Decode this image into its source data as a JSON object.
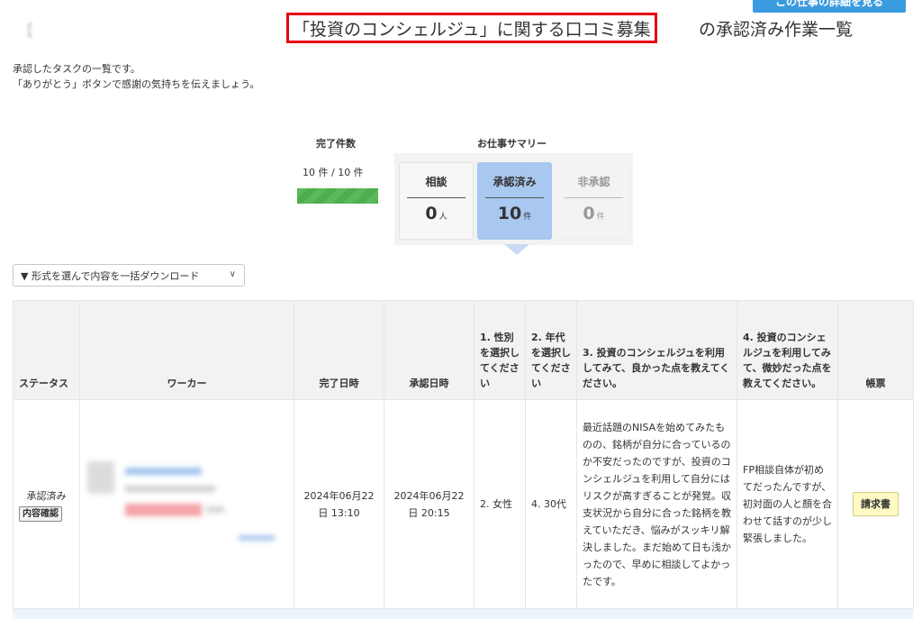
{
  "header": {
    "title_prefix": "【",
    "highlighted_title": "「投資のコンシェルジュ」に関する口コミ募集",
    "title_suffix": "の承認済み作業一覧",
    "detail_button": "この仕事の詳細を見る"
  },
  "description": {
    "line1": "承認したタスクの一覧です。",
    "line2": "「ありがとう」ボタンで感謝の気持ちを伝えましょう。"
  },
  "summary": {
    "completed_label": "完了件数",
    "completed_text": "10 件 / 10 件",
    "completed_progress": 1.0,
    "work_summary_label": "お仕事サマリー",
    "cards": [
      {
        "label": "相談",
        "count": "0",
        "unit": "人"
      },
      {
        "label": "承認済み",
        "count": "10",
        "unit": "件"
      },
      {
        "label": "非承認",
        "count": "0",
        "unit": "件"
      }
    ]
  },
  "download": {
    "label": "▼ 形式を選んで内容を一括ダウンロード",
    "chevron": "∨"
  },
  "table": {
    "headers": {
      "status": "ステータス",
      "worker": "ワーカー",
      "completed": "完了日時",
      "approved": "承認日時",
      "q1": "1. 性別を選択してください",
      "q2": "2. 年代を選択してください",
      "q3": "3. 投資のコンシェルジュを利用してみて、良かった点を教えてください。",
      "q4": "4. 投資のコンシェルジュを利用してみて、微妙だった点を教えてください。",
      "invoice": "帳票"
    },
    "rows": [
      {
        "status": "承認済み",
        "status_badge": "内容確認",
        "completed": "2024年06月22日 13:10",
        "approved": "2024年06月22日 20:15",
        "q1": "2. 女性",
        "q2": "4. 30代",
        "q3": "最近話題のNISAを始めてみたものの、銘柄が自分に合っているのか不安だったのですが、投資のコンシェルジュを利用して自分にはリスクが高すぎることが発覚。収支状況から自分に合った銘柄を教えていただき、悩みがスッキリ解決しました。まだ始めて日も浅かったので、早めに相談してよかったです。",
        "q4": "FP相談自体が初めてだったんですが、初対面の人と顏を合わせて話すのが少し緊張しました。",
        "invoice_button": "請求書"
      }
    ]
  },
  "colors": {
    "highlight_border": "#e60012",
    "accent_blue": "#3b9be0",
    "active_card": "#a8c8ef",
    "progress_green": "#5cb85c",
    "invoice_yellow": "#fff9c4"
  }
}
